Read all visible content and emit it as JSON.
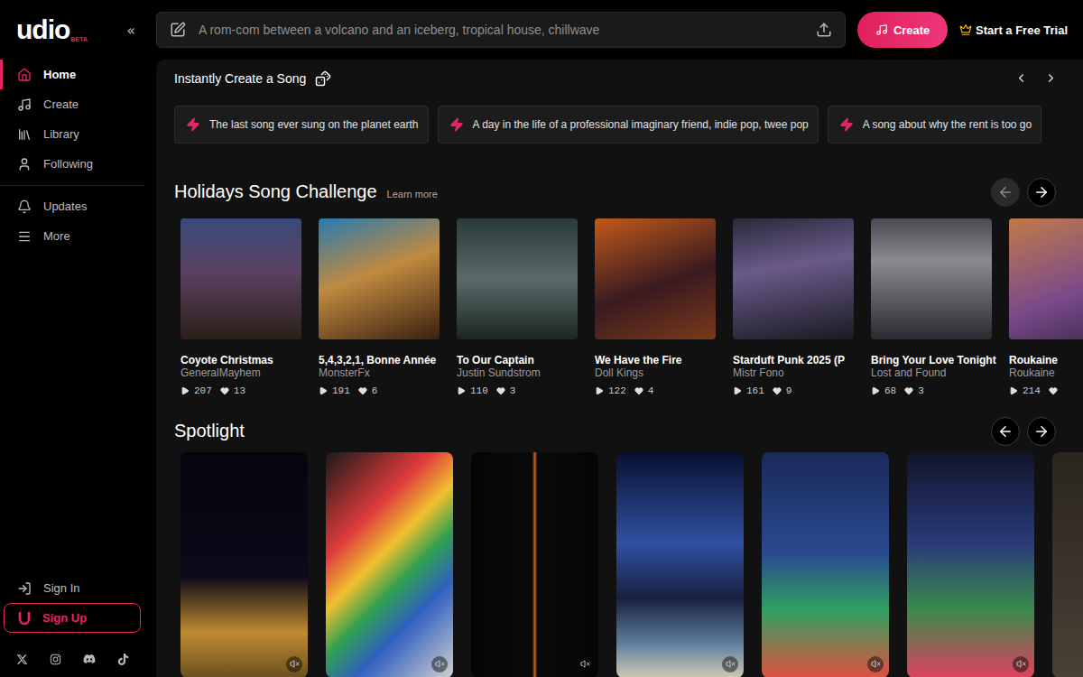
{
  "logo": {
    "text": "udio",
    "badge": "BETA"
  },
  "collapse": "«",
  "sidebar": {
    "items": [
      {
        "label": "Home",
        "selected": true
      },
      {
        "label": "Create",
        "selected": false
      },
      {
        "label": "Library",
        "selected": false
      },
      {
        "label": "Following",
        "selected": false
      }
    ],
    "secondary": [
      {
        "label": "Updates",
        "selected": false
      },
      {
        "label": "More",
        "selected": false
      }
    ],
    "sign_in": "Sign In",
    "sign_up": "Sign Up"
  },
  "search": {
    "placeholder": "A rom-com between a volcano and an iceberg, tropical house, chillwave"
  },
  "create_button": "Create",
  "trial": "Start a Free Trial",
  "quick": {
    "title": "Instantly Create a Song",
    "prompts": [
      "The last song ever sung on the planet earth",
      "A day in the life of a professional imaginary friend, indie pop, twee pop",
      "A song about why the rent is too go"
    ]
  },
  "challenge": {
    "title": "Holidays Song Challenge",
    "link": "Learn more",
    "prev_disabled": true,
    "next_disabled": false,
    "songs": [
      {
        "title": "Coyote Christmas",
        "artist": "GeneralMayhem",
        "plays": "207",
        "likes": "13"
      },
      {
        "title": "5,4,3,2,1, Bonne Année",
        "artist": "MonsterFx",
        "plays": "191",
        "likes": "6"
      },
      {
        "title": "To Our Captain",
        "artist": "Justin Sundstrom",
        "plays": "110",
        "likes": "3"
      },
      {
        "title": "We Have the Fire",
        "artist": "Doll Kings",
        "plays": "122",
        "likes": "4"
      },
      {
        "title": "Starduft Punk 2025 (P",
        "artist": "Mistr Fono",
        "plays": "161",
        "likes": "9"
      },
      {
        "title": "Bring Your Love Tonight",
        "artist": "Lost and Found",
        "plays": "68",
        "likes": "3"
      },
      {
        "title": "Roukaine",
        "artist": "Roukaine",
        "plays": "214"
      }
    ]
  },
  "spotlight": {
    "title": "Spotlight",
    "prev_disabled": false,
    "next_disabled": false,
    "items": [
      {
        "muted": true
      },
      {
        "muted": true
      },
      {
        "muted": true
      },
      {
        "muted": true
      },
      {
        "muted": true
      },
      {
        "muted": true
      },
      {
        "muted": true
      }
    ]
  }
}
